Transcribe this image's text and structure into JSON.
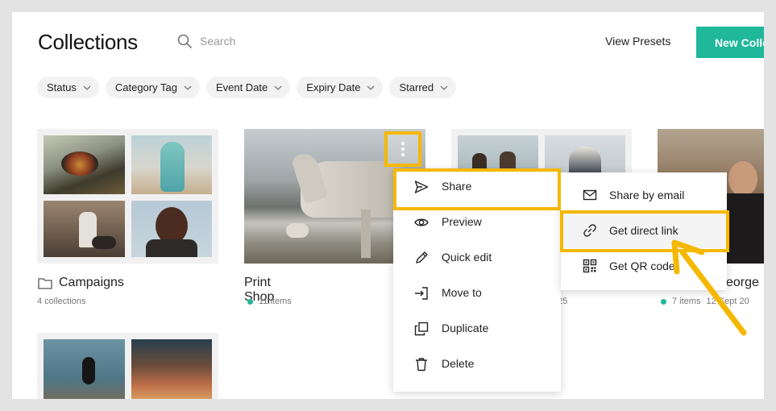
{
  "page": {
    "title": "Collections",
    "search_placeholder": "Search",
    "view_presets_label": "View Presets",
    "new_button_label": "New Colle"
  },
  "filters": [
    {
      "label": "Status"
    },
    {
      "label": "Category Tag"
    },
    {
      "label": "Event Date"
    },
    {
      "label": "Expiry Date"
    },
    {
      "label": "Starred"
    }
  ],
  "cards": [
    {
      "title": "Campaigns",
      "subtitle": "4 collections"
    },
    {
      "title": "Print Shop",
      "subtitle": "11 items"
    },
    {
      "title": "",
      "subtitle": "025"
    },
    {
      "title": "eorge",
      "subtitle_count": "7 items",
      "subtitle_date": "12 Sept 20"
    }
  ],
  "context_menu": {
    "items": [
      {
        "label": "Share",
        "icon": "send-icon"
      },
      {
        "label": "Preview",
        "icon": "eye-icon"
      },
      {
        "label": "Quick edit",
        "icon": "pencil-icon"
      },
      {
        "label": "Move to",
        "icon": "move-to-icon"
      },
      {
        "label": "Duplicate",
        "icon": "duplicate-icon"
      },
      {
        "label": "Delete",
        "icon": "trash-icon"
      }
    ]
  },
  "share_submenu": {
    "items": [
      {
        "label": "Share by email",
        "icon": "envelope-icon"
      },
      {
        "label": "Get direct link",
        "icon": "link-icon"
      },
      {
        "label": "Get QR code",
        "icon": "qr-code-icon"
      }
    ]
  },
  "colors": {
    "accent": "#1fb89a",
    "highlight": "#f5b800"
  }
}
